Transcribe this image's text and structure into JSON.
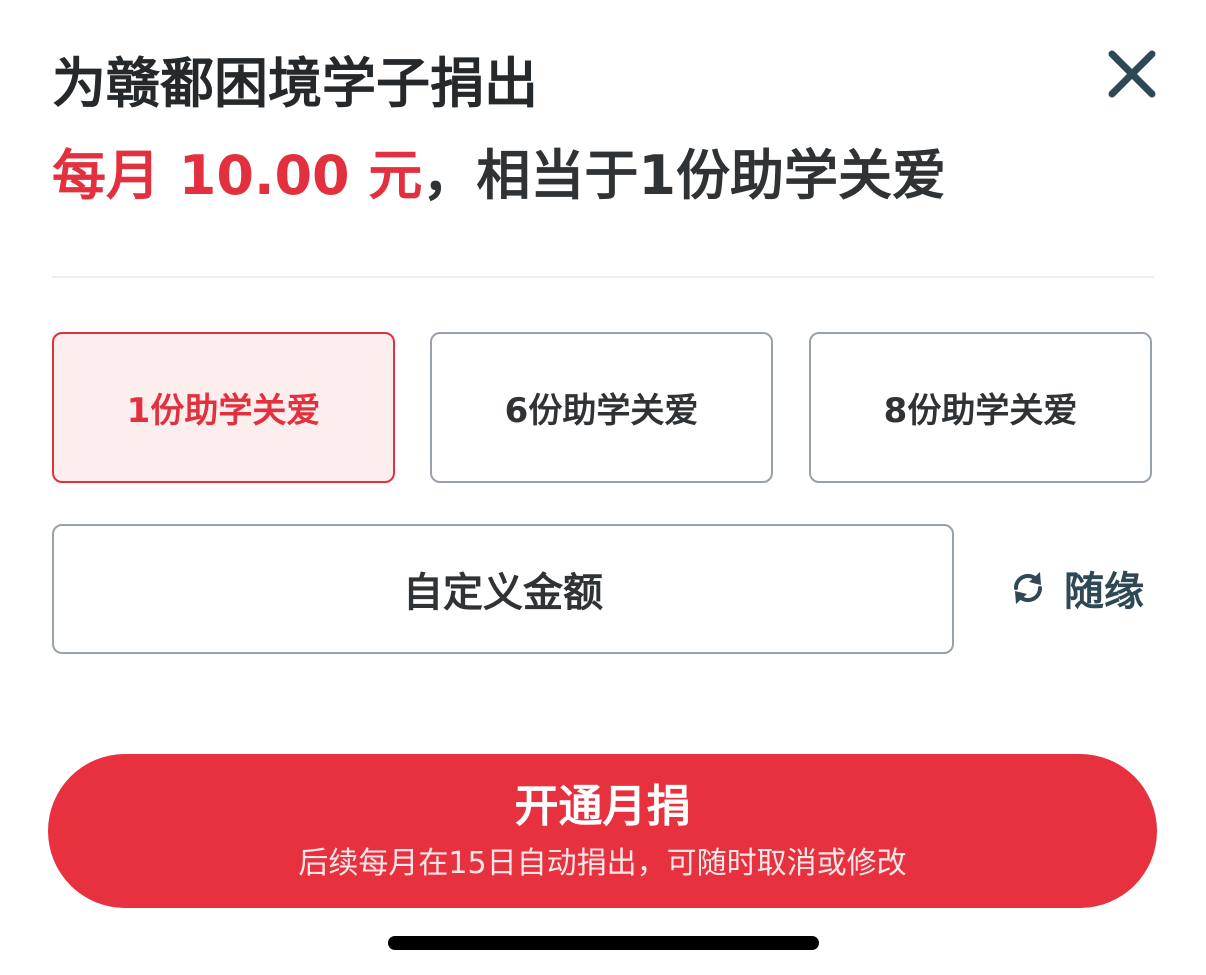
{
  "header": {
    "title": "为赣鄱困境学子捐出",
    "close_icon": "close-icon"
  },
  "summary": {
    "amount_text": "每月 10.00 元",
    "rest_text": "，相当于1份助学关爱",
    "accent_color": "#e3303f"
  },
  "options": [
    {
      "label": "1份助学关爱",
      "selected": true
    },
    {
      "label": "6份助学关爱",
      "selected": false
    },
    {
      "label": "8份助学关爱",
      "selected": false
    }
  ],
  "custom": {
    "label": "自定义金额"
  },
  "random": {
    "label": "随缘",
    "icon": "refresh-icon"
  },
  "cta": {
    "label": "开通月捐",
    "note": "后续每月在15日自动捐出，可随时取消或修改",
    "color": "#e7313f"
  }
}
